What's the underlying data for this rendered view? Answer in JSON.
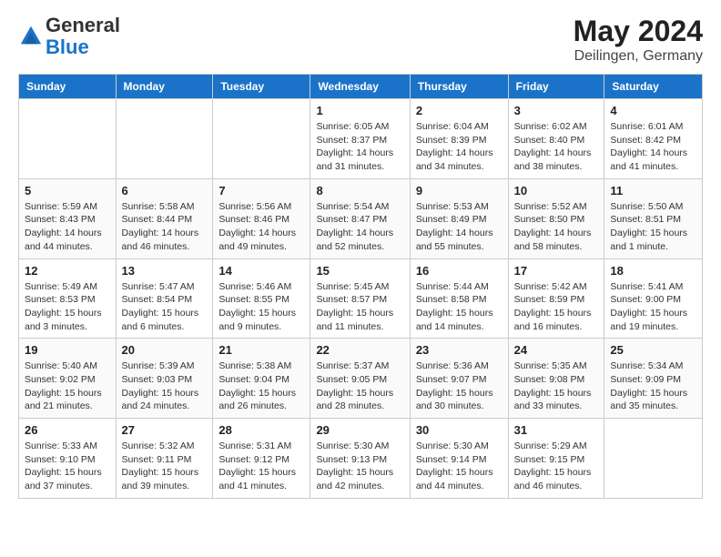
{
  "header": {
    "logo_general": "General",
    "logo_blue": "Blue",
    "month": "May 2024",
    "location": "Deilingen, Germany"
  },
  "days_of_week": [
    "Sunday",
    "Monday",
    "Tuesday",
    "Wednesday",
    "Thursday",
    "Friday",
    "Saturday"
  ],
  "weeks": [
    [
      {
        "day": "",
        "info": ""
      },
      {
        "day": "",
        "info": ""
      },
      {
        "day": "",
        "info": ""
      },
      {
        "day": "1",
        "info": "Sunrise: 6:05 AM\nSunset: 8:37 PM\nDaylight: 14 hours\nand 31 minutes."
      },
      {
        "day": "2",
        "info": "Sunrise: 6:04 AM\nSunset: 8:39 PM\nDaylight: 14 hours\nand 34 minutes."
      },
      {
        "day": "3",
        "info": "Sunrise: 6:02 AM\nSunset: 8:40 PM\nDaylight: 14 hours\nand 38 minutes."
      },
      {
        "day": "4",
        "info": "Sunrise: 6:01 AM\nSunset: 8:42 PM\nDaylight: 14 hours\nand 41 minutes."
      }
    ],
    [
      {
        "day": "5",
        "info": "Sunrise: 5:59 AM\nSunset: 8:43 PM\nDaylight: 14 hours\nand 44 minutes."
      },
      {
        "day": "6",
        "info": "Sunrise: 5:58 AM\nSunset: 8:44 PM\nDaylight: 14 hours\nand 46 minutes."
      },
      {
        "day": "7",
        "info": "Sunrise: 5:56 AM\nSunset: 8:46 PM\nDaylight: 14 hours\nand 49 minutes."
      },
      {
        "day": "8",
        "info": "Sunrise: 5:54 AM\nSunset: 8:47 PM\nDaylight: 14 hours\nand 52 minutes."
      },
      {
        "day": "9",
        "info": "Sunrise: 5:53 AM\nSunset: 8:49 PM\nDaylight: 14 hours\nand 55 minutes."
      },
      {
        "day": "10",
        "info": "Sunrise: 5:52 AM\nSunset: 8:50 PM\nDaylight: 14 hours\nand 58 minutes."
      },
      {
        "day": "11",
        "info": "Sunrise: 5:50 AM\nSunset: 8:51 PM\nDaylight: 15 hours\nand 1 minute."
      }
    ],
    [
      {
        "day": "12",
        "info": "Sunrise: 5:49 AM\nSunset: 8:53 PM\nDaylight: 15 hours\nand 3 minutes."
      },
      {
        "day": "13",
        "info": "Sunrise: 5:47 AM\nSunset: 8:54 PM\nDaylight: 15 hours\nand 6 minutes."
      },
      {
        "day": "14",
        "info": "Sunrise: 5:46 AM\nSunset: 8:55 PM\nDaylight: 15 hours\nand 9 minutes."
      },
      {
        "day": "15",
        "info": "Sunrise: 5:45 AM\nSunset: 8:57 PM\nDaylight: 15 hours\nand 11 minutes."
      },
      {
        "day": "16",
        "info": "Sunrise: 5:44 AM\nSunset: 8:58 PM\nDaylight: 15 hours\nand 14 minutes."
      },
      {
        "day": "17",
        "info": "Sunrise: 5:42 AM\nSunset: 8:59 PM\nDaylight: 15 hours\nand 16 minutes."
      },
      {
        "day": "18",
        "info": "Sunrise: 5:41 AM\nSunset: 9:00 PM\nDaylight: 15 hours\nand 19 minutes."
      }
    ],
    [
      {
        "day": "19",
        "info": "Sunrise: 5:40 AM\nSunset: 9:02 PM\nDaylight: 15 hours\nand 21 minutes."
      },
      {
        "day": "20",
        "info": "Sunrise: 5:39 AM\nSunset: 9:03 PM\nDaylight: 15 hours\nand 24 minutes."
      },
      {
        "day": "21",
        "info": "Sunrise: 5:38 AM\nSunset: 9:04 PM\nDaylight: 15 hours\nand 26 minutes."
      },
      {
        "day": "22",
        "info": "Sunrise: 5:37 AM\nSunset: 9:05 PM\nDaylight: 15 hours\nand 28 minutes."
      },
      {
        "day": "23",
        "info": "Sunrise: 5:36 AM\nSunset: 9:07 PM\nDaylight: 15 hours\nand 30 minutes."
      },
      {
        "day": "24",
        "info": "Sunrise: 5:35 AM\nSunset: 9:08 PM\nDaylight: 15 hours\nand 33 minutes."
      },
      {
        "day": "25",
        "info": "Sunrise: 5:34 AM\nSunset: 9:09 PM\nDaylight: 15 hours\nand 35 minutes."
      }
    ],
    [
      {
        "day": "26",
        "info": "Sunrise: 5:33 AM\nSunset: 9:10 PM\nDaylight: 15 hours\nand 37 minutes."
      },
      {
        "day": "27",
        "info": "Sunrise: 5:32 AM\nSunset: 9:11 PM\nDaylight: 15 hours\nand 39 minutes."
      },
      {
        "day": "28",
        "info": "Sunrise: 5:31 AM\nSunset: 9:12 PM\nDaylight: 15 hours\nand 41 minutes."
      },
      {
        "day": "29",
        "info": "Sunrise: 5:30 AM\nSunset: 9:13 PM\nDaylight: 15 hours\nand 42 minutes."
      },
      {
        "day": "30",
        "info": "Sunrise: 5:30 AM\nSunset: 9:14 PM\nDaylight: 15 hours\nand 44 minutes."
      },
      {
        "day": "31",
        "info": "Sunrise: 5:29 AM\nSunset: 9:15 PM\nDaylight: 15 hours\nand 46 minutes."
      },
      {
        "day": "",
        "info": ""
      }
    ]
  ]
}
